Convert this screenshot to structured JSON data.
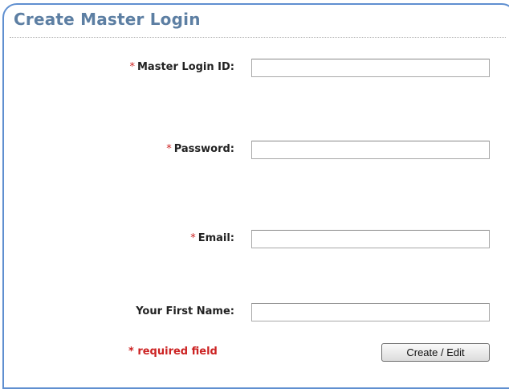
{
  "form": {
    "title": "Create Master Login",
    "required_marker": "*",
    "fields": [
      {
        "label": "Master Login ID:",
        "required": true,
        "value": ""
      },
      {
        "label": "Password:",
        "required": true,
        "value": ""
      },
      {
        "label": "Email:",
        "required": true,
        "value": ""
      },
      {
        "label": "Your First Name:",
        "required": false,
        "value": ""
      }
    ],
    "required_note": "* required field",
    "submit_label": "Create / Edit"
  },
  "colors": {
    "title": "#5d7fa3",
    "border": "#5f8fd0",
    "required": "#cc2222"
  }
}
